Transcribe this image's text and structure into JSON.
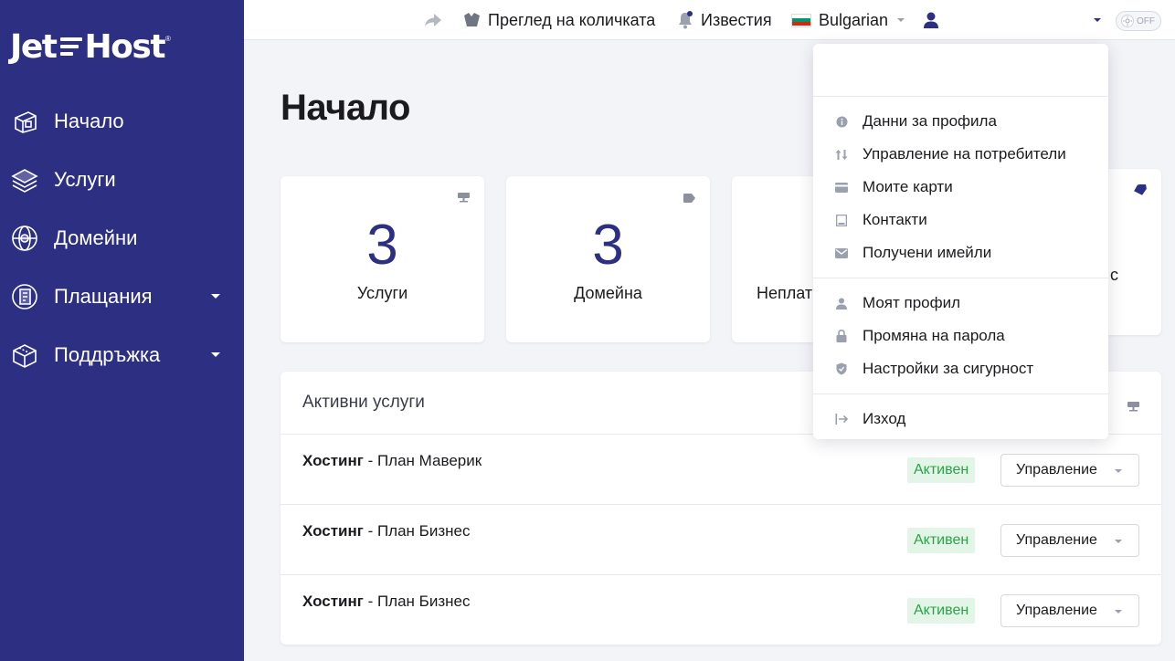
{
  "brand": {
    "name_left": "Jet",
    "name_right": "Host",
    "mark": "®"
  },
  "sidebar": {
    "items": [
      {
        "label": "Начало",
        "icon": "home-icon",
        "caret": false
      },
      {
        "label": "Услуги",
        "icon": "layers-icon",
        "caret": false
      },
      {
        "label": "Домейни",
        "icon": "globe-icon",
        "caret": false
      },
      {
        "label": "Плащания",
        "icon": "invoice-icon",
        "caret": true
      },
      {
        "label": "Поддръжка",
        "icon": "support-box-icon",
        "caret": true
      }
    ]
  },
  "topbar": {
    "cart_label": "Преглед на количката",
    "notifications_label": "Известия",
    "language_label": "Bulgarian",
    "toggle_label": "OFF"
  },
  "page": {
    "title": "Начало"
  },
  "stats": [
    {
      "value": "3",
      "label": "Услуги",
      "icon": "server-icon"
    },
    {
      "value": "3",
      "label": "Домейна",
      "icon": "tag-icon"
    },
    {
      "value": "",
      "label": "Неплат",
      "icon": ""
    },
    {
      "value": "",
      "label": "с",
      "icon": "ticket-icon"
    }
  ],
  "active_services": {
    "title": "Активни услуги",
    "rows": [
      {
        "type": "Хостинг",
        "plan": " - План Маверик",
        "status": "Активен",
        "button": "Управление"
      },
      {
        "type": "Хостинг",
        "plan": " - План Бизнес",
        "status": "Активен",
        "button": "Управление"
      },
      {
        "type": "Хостинг",
        "plan": " - План Бизнес",
        "status": "Активен",
        "button": "Управление"
      }
    ]
  },
  "account_menu": {
    "groups": [
      [
        {
          "label": "Данни за профила",
          "icon": "info-circle-icon"
        },
        {
          "label": "Управление на потребители",
          "icon": "swap-arrows-icon"
        },
        {
          "label": "Моите карти",
          "icon": "credit-card-icon"
        },
        {
          "label": "Контакти",
          "icon": "contact-book-icon"
        },
        {
          "label": "Получени имейли",
          "icon": "envelope-icon"
        }
      ],
      [
        {
          "label": "Моят профил",
          "icon": "user-icon"
        },
        {
          "label": "Промяна на парола",
          "icon": "lock-icon"
        },
        {
          "label": "Настройки за сигурност",
          "icon": "shield-icon"
        }
      ],
      [
        {
          "label": "Изход",
          "icon": "logout-icon"
        }
      ]
    ]
  },
  "colors": {
    "sidebar_bg": "#2d2f83",
    "accent": "#2d2f83",
    "status_green": "#2ca24a",
    "status_green_bg": "#e3f5e6"
  }
}
